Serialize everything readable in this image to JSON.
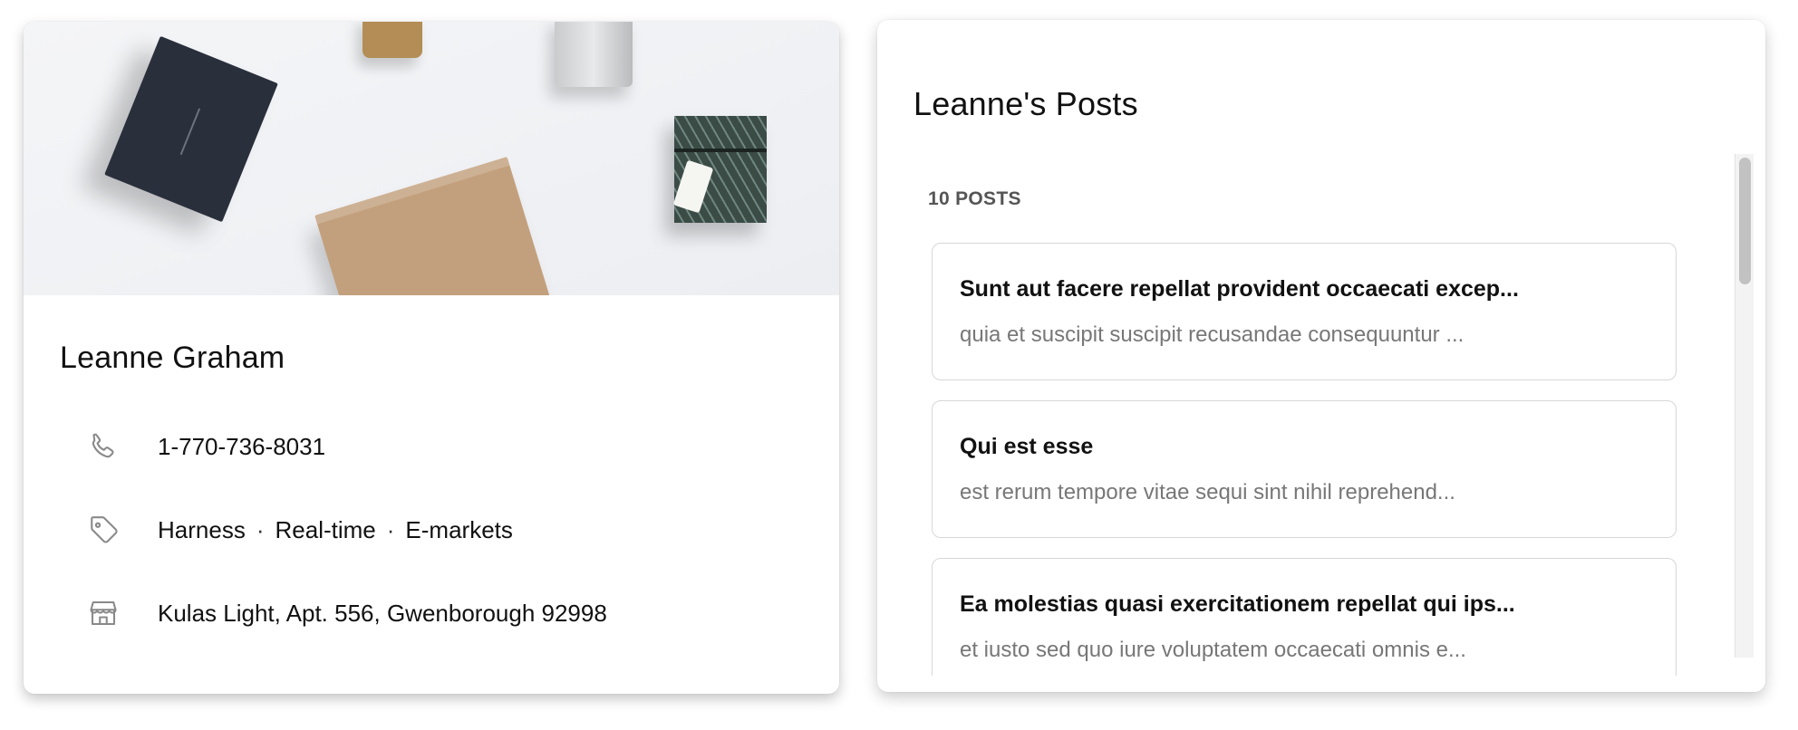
{
  "profile": {
    "name": "Leanne Graham",
    "phone": "1-770-736-8031",
    "tags": [
      "Harness",
      "Real-time",
      "E-markets"
    ],
    "tag_separator": "·",
    "address": "Kulas Light, Apt. 556, Gwenborough 92998",
    "icons": {
      "phone": "phone-icon",
      "tags": "tag-icon",
      "address": "store-icon"
    }
  },
  "posts": {
    "title": "Leanne's Posts",
    "count_label": "10 POSTS",
    "items": [
      {
        "title": "Sunt aut facere repellat provident occaecati excep...",
        "body": "quia et suscipit suscipit recusandae consequuntur ..."
      },
      {
        "title": "Qui est esse",
        "body": "est rerum tempore vitae sequi sint nihil reprehend..."
      },
      {
        "title": "Ea molestias quasi exercitationem repellat qui ips...",
        "body": "et iusto sed quo iure voluptatem occaecati omnis e..."
      }
    ]
  }
}
